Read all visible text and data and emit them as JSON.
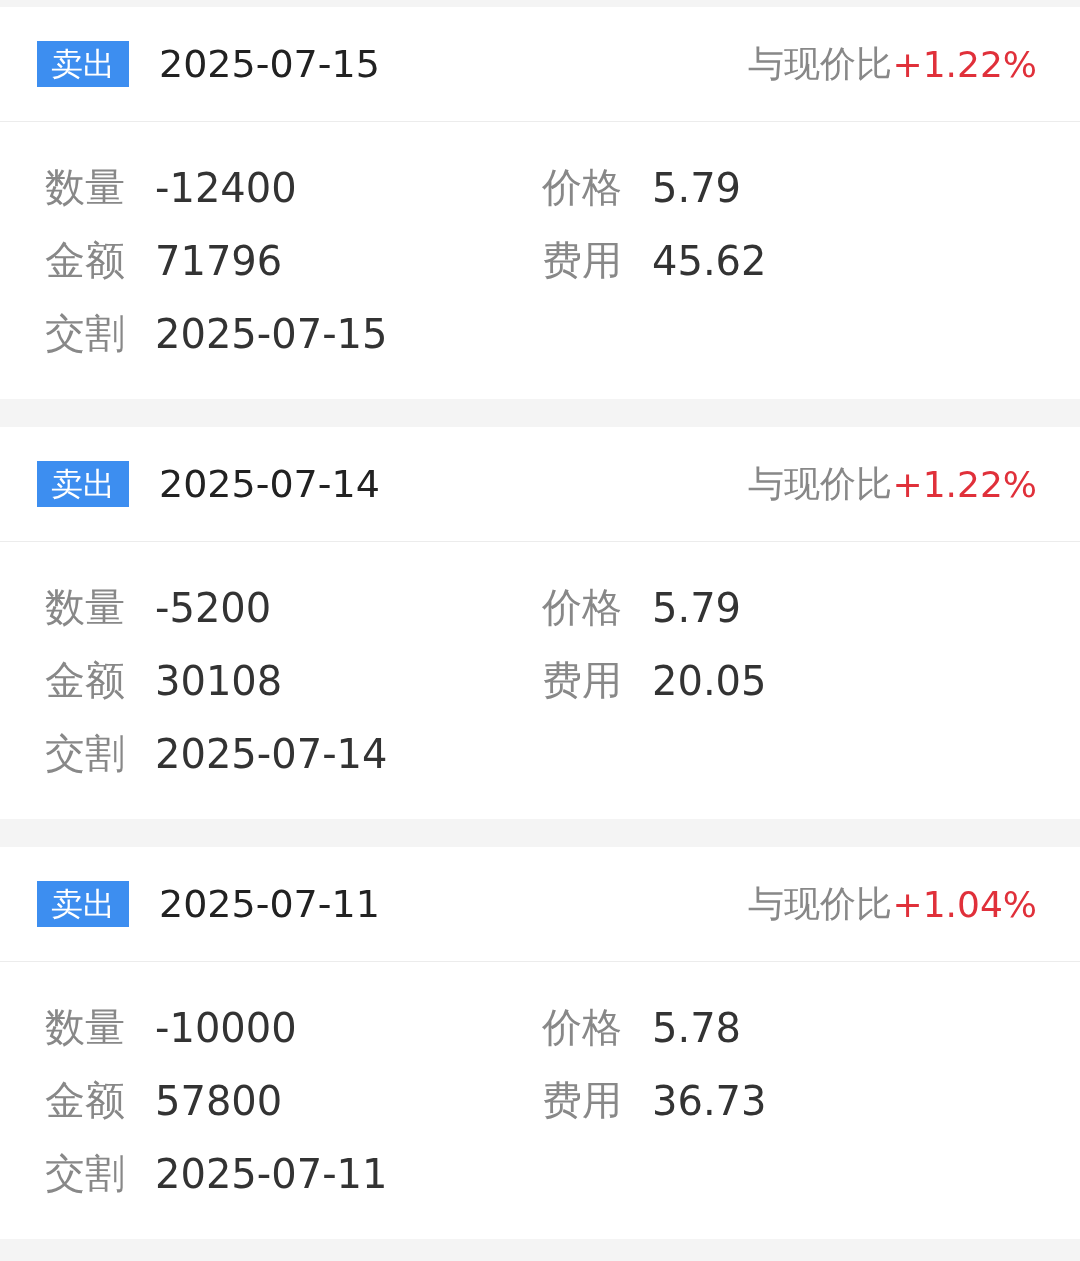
{
  "trades": [
    {
      "type": "卖出",
      "date": "2025-07-15",
      "compare_label": "与现价比",
      "change": "+1.22%",
      "fields": [
        {
          "label": "数量",
          "value": "-12400"
        },
        {
          "label": "价格",
          "value": "5.79"
        },
        {
          "label": "金额",
          "value": "71796"
        },
        {
          "label": "费用",
          "value": "45.62"
        },
        {
          "label": "交割",
          "value": "2025-07-15"
        }
      ]
    },
    {
      "type": "卖出",
      "date": "2025-07-14",
      "compare_label": "与现价比",
      "change": "+1.22%",
      "fields": [
        {
          "label": "数量",
          "value": "-5200"
        },
        {
          "label": "价格",
          "value": "5.79"
        },
        {
          "label": "金额",
          "value": "30108"
        },
        {
          "label": "费用",
          "value": "20.05"
        },
        {
          "label": "交割",
          "value": "2025-07-14"
        }
      ]
    },
    {
      "type": "卖出",
      "date": "2025-07-11",
      "compare_label": "与现价比",
      "change": "+1.04%",
      "fields": [
        {
          "label": "数量",
          "value": "-10000"
        },
        {
          "label": "价格",
          "value": "5.78"
        },
        {
          "label": "金额",
          "value": "57800"
        },
        {
          "label": "费用",
          "value": "36.73"
        },
        {
          "label": "交割",
          "value": "2025-07-11"
        }
      ]
    }
  ]
}
